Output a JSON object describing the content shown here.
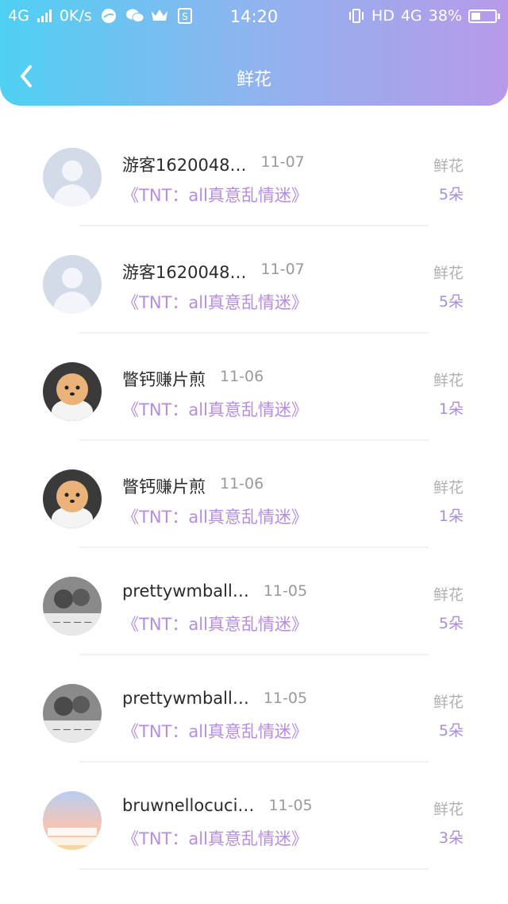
{
  "status_bar": {
    "network": "4G",
    "speed": "0K/s",
    "time": "14:20",
    "hd": "HD",
    "net_right": "4G",
    "battery": "38%",
    "icons": [
      "browser-icon",
      "wechat-icon",
      "crown-icon",
      "s-app-icon",
      "vibrate-icon"
    ]
  },
  "header": {
    "title": "鲜花"
  },
  "items": [
    {
      "name": "游客1620048…",
      "date": "11-07",
      "book": "《TNT：all真意乱情迷》",
      "type": "鲜花",
      "count": "5朵",
      "avatar": "default"
    },
    {
      "name": "游客1620048…",
      "date": "11-07",
      "book": "《TNT：all真意乱情迷》",
      "type": "鲜花",
      "count": "5朵",
      "avatar": "default"
    },
    {
      "name": "瞥钙赚片煎",
      "date": "11-06",
      "book": "《TNT：all真意乱情迷》",
      "type": "鲜花",
      "count": "1朵",
      "avatar": "dog"
    },
    {
      "name": "瞥钙赚片煎",
      "date": "11-06",
      "book": "《TNT：all真意乱情迷》",
      "type": "鲜花",
      "count": "1朵",
      "avatar": "dog"
    },
    {
      "name": "prettywmball…",
      "date": "11-05",
      "book": "《TNT：all真意乱情迷》",
      "type": "鲜花",
      "count": "5朵",
      "avatar": "photo"
    },
    {
      "name": "prettywmball…",
      "date": "11-05",
      "book": "《TNT：all真意乱情迷》",
      "type": "鲜花",
      "count": "5朵",
      "avatar": "photo"
    },
    {
      "name": "bruwnellocuci…",
      "date": "11-05",
      "book": "《TNT：all真意乱情迷》",
      "type": "鲜花",
      "count": "3朵",
      "avatar": "keyboard"
    }
  ]
}
